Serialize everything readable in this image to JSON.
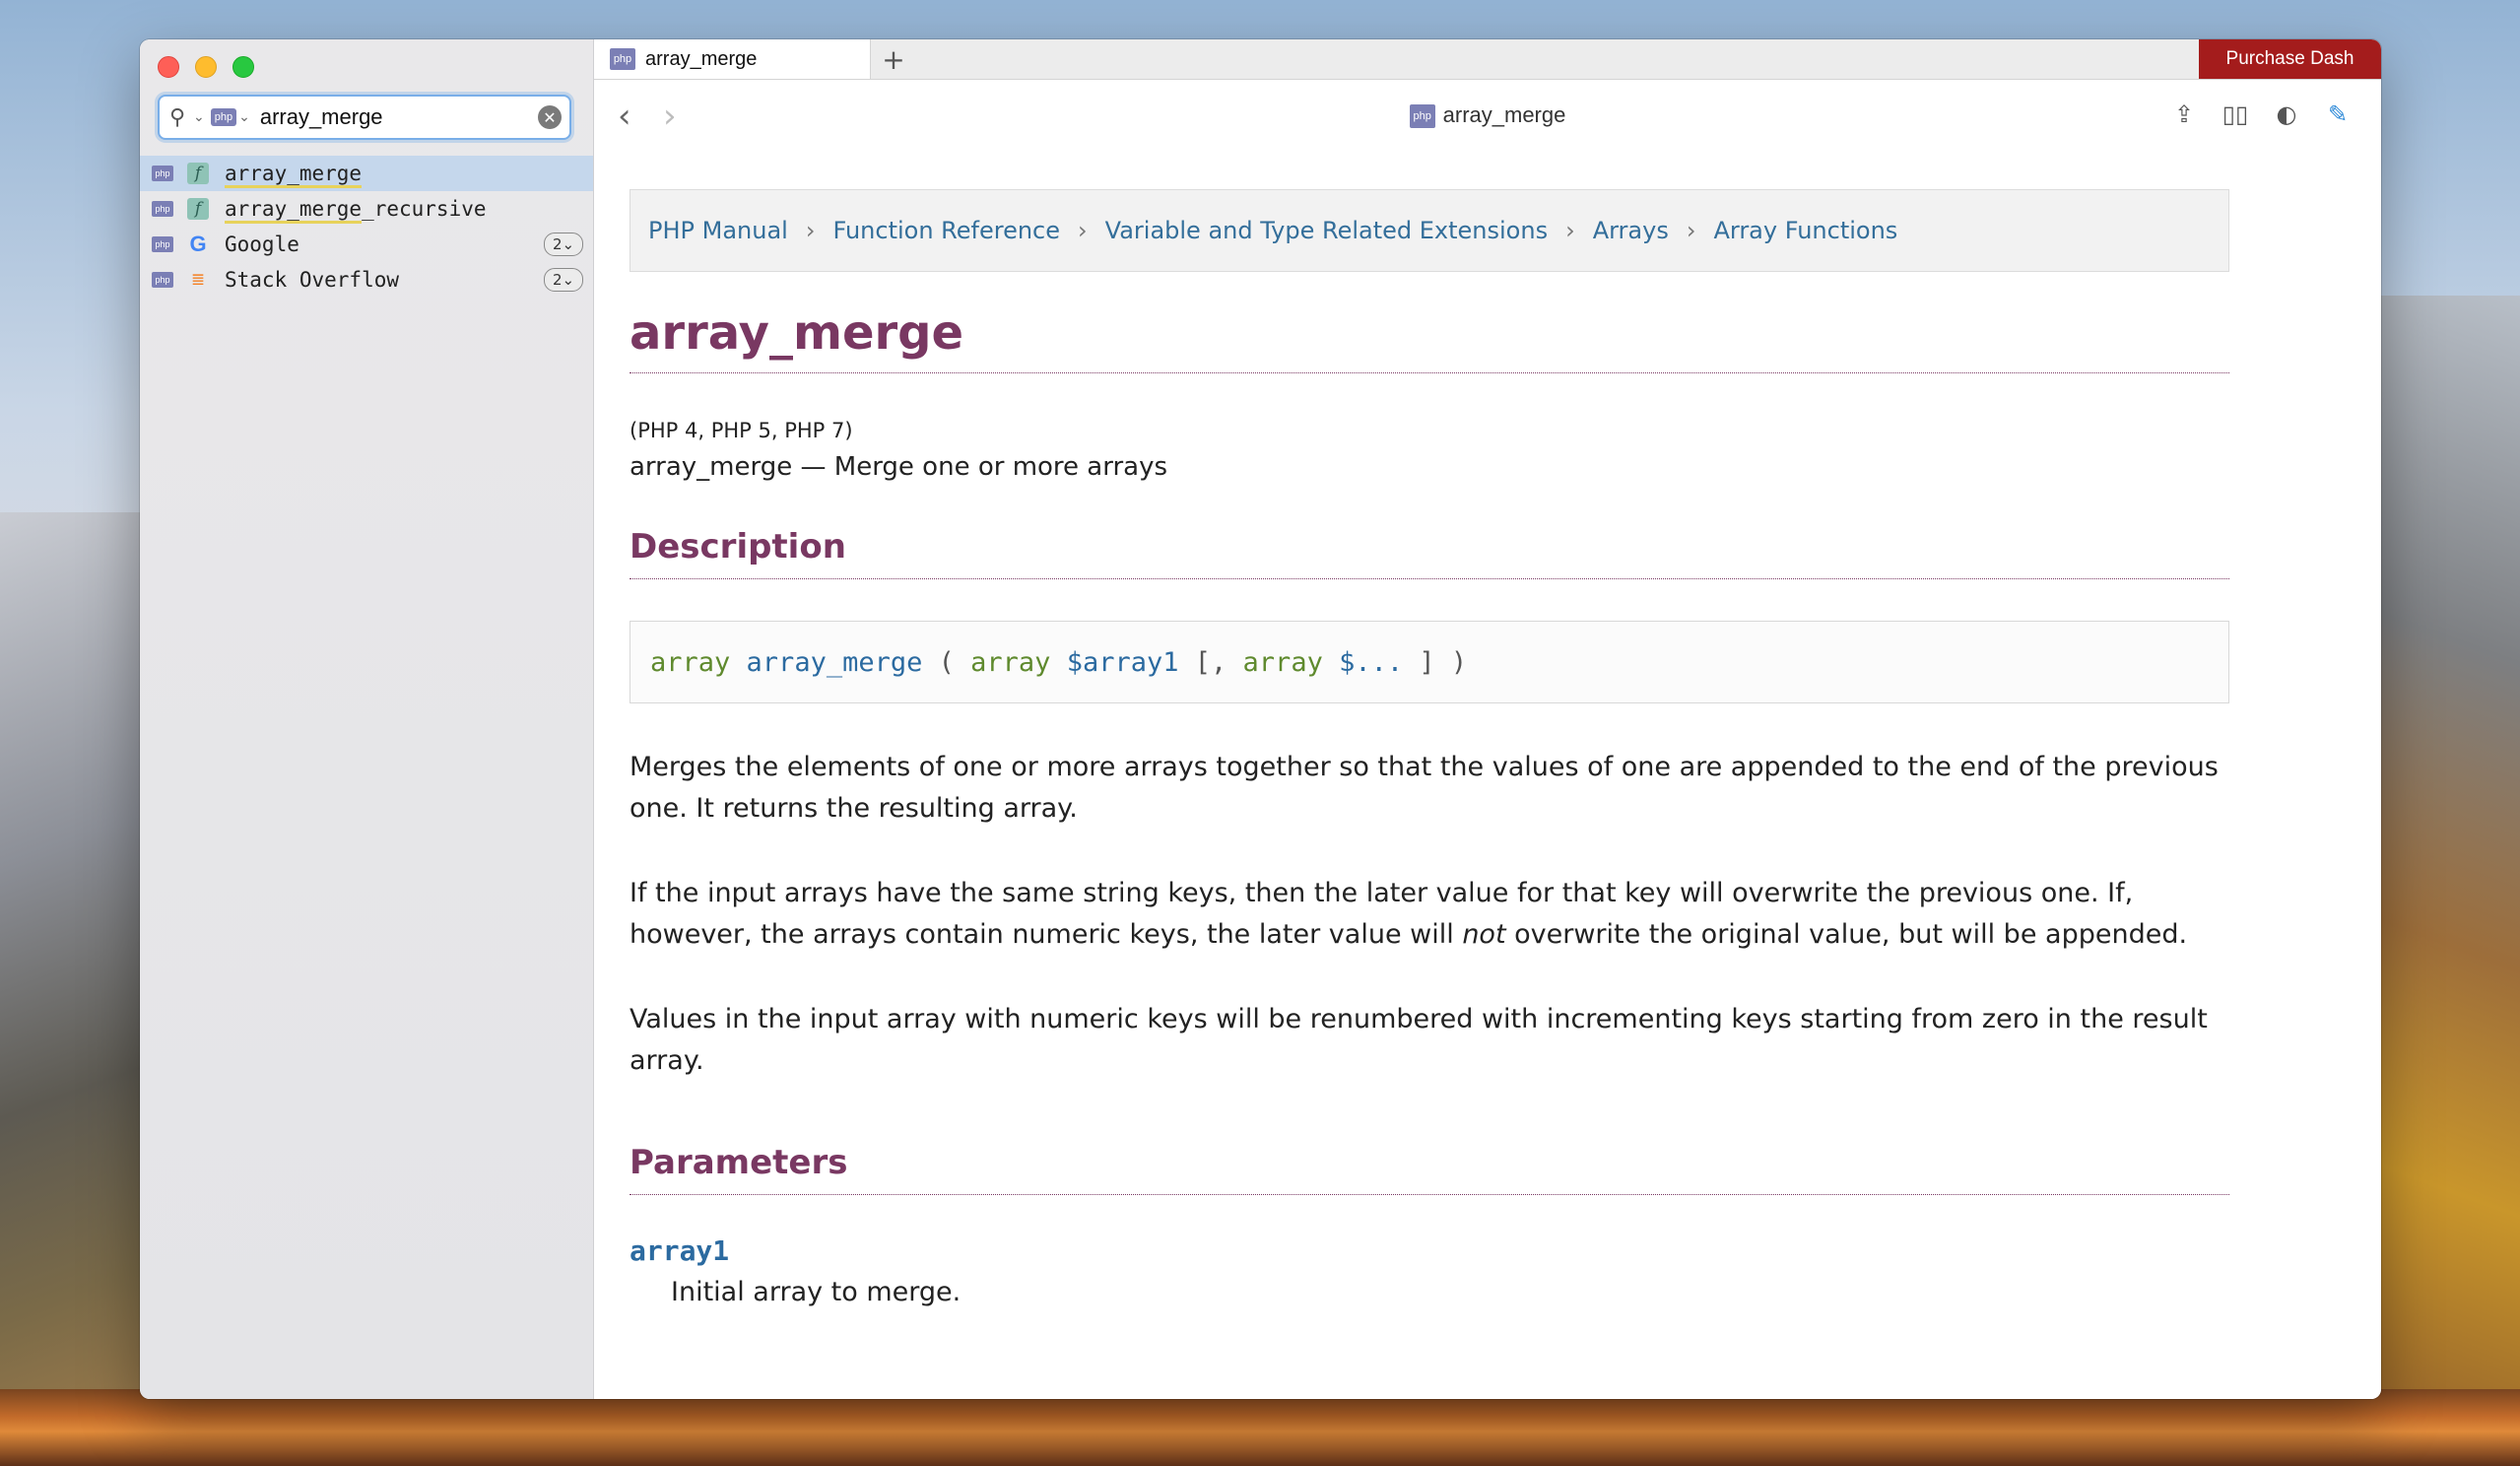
{
  "search": {
    "query": "array_merge",
    "docset_chip": "php"
  },
  "results": [
    {
      "docset": "php",
      "type": "f",
      "label": "array_merge",
      "highlight": "array_merge",
      "rest": "",
      "badge": ""
    },
    {
      "docset": "php",
      "type": "f",
      "label": "array_merge_recursive",
      "highlight": "array_merge",
      "rest": "_recursive",
      "badge": ""
    },
    {
      "docset": "php",
      "type": "G",
      "label": "Google",
      "highlight": "",
      "rest": "Google",
      "badge": "2⌄"
    },
    {
      "docset": "php",
      "type": "so",
      "label": "Stack Overflow",
      "highlight": "",
      "rest": "Stack Overflow",
      "badge": "2⌄"
    }
  ],
  "tab": {
    "icon": "php",
    "label": "array_merge"
  },
  "purchase_label": "Purchase Dash",
  "toolbar": {
    "title": "array_merge",
    "title_icon": "php"
  },
  "doc": {
    "breadcrumbs": [
      "PHP Manual",
      "Function Reference",
      "Variable and Type Related Extensions",
      "Arrays",
      "Array Functions"
    ],
    "title": "array_merge",
    "versions": "(PHP 4, PHP 5, PHP 7)",
    "refname": "array_merge — Merge one or more arrays",
    "description_heading": "Description",
    "signature": {
      "ret_type": "array",
      "fn": "array_merge",
      "open": "(",
      "p1_type": "array",
      "p1_var": "$array1",
      "opt_open": "[,",
      "p2_type": "array",
      "p2_var": "$...",
      "close": "] )"
    },
    "para1": "Merges the elements of one or more arrays together so that the values of one are appended to the end of the previous one. It returns the resulting array.",
    "para2_a": "If the input arrays have the same string keys, then the later value for that key will overwrite the previous one. If, however, the arrays contain numeric keys, the later value will ",
    "para2_em": "not",
    "para2_b": " overwrite the original value, but will be appended.",
    "para3": "Values in the input array with numeric keys will be renumbered with incrementing keys starting from zero in the result array.",
    "parameters_heading": "Parameters",
    "param1_name": "array1",
    "param1_desc": "Initial array to merge."
  }
}
